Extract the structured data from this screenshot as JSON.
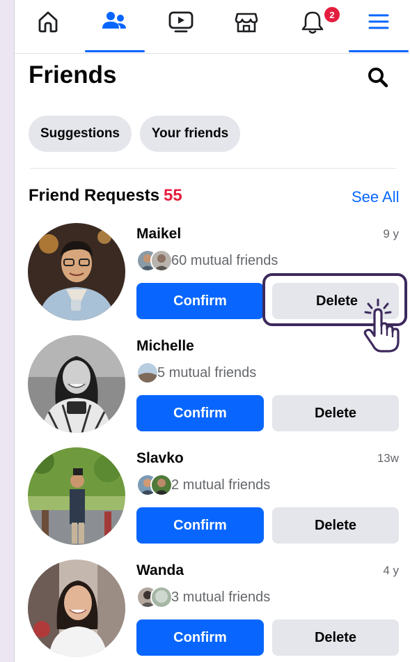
{
  "nav": {
    "items": [
      {
        "name": "home-icon"
      },
      {
        "name": "friends-icon"
      },
      {
        "name": "video-icon"
      },
      {
        "name": "marketplace-icon"
      },
      {
        "name": "bell-icon",
        "badge": "2"
      },
      {
        "name": "menu-icon"
      }
    ],
    "active_color": "#0866ff"
  },
  "header": {
    "title": "Friends"
  },
  "chips": {
    "suggestions": "Suggestions",
    "your_friends": "Your friends"
  },
  "requests": {
    "title": "Friend Requests",
    "count": "55",
    "see_all": "See All",
    "items": [
      {
        "name": "Maikel",
        "time": "9 y",
        "mutual": "60 mutual friends",
        "confirm": "Confirm",
        "delete": "Delete"
      },
      {
        "name": "Michelle",
        "time": "",
        "mutual": "5 mutual friends",
        "confirm": "Confirm",
        "delete": "Delete"
      },
      {
        "name": "Slavko",
        "time": "13w",
        "mutual": "2 mutual friends",
        "confirm": "Confirm",
        "delete": "Delete"
      },
      {
        "name": "Wanda",
        "time": "4 y",
        "mutual": "3 mutual friends",
        "confirm": "Confirm",
        "delete": "Delete"
      }
    ]
  },
  "colors": {
    "primary": "#0866ff",
    "count_red": "#e41e3f",
    "highlight": "#3d2a5c"
  }
}
